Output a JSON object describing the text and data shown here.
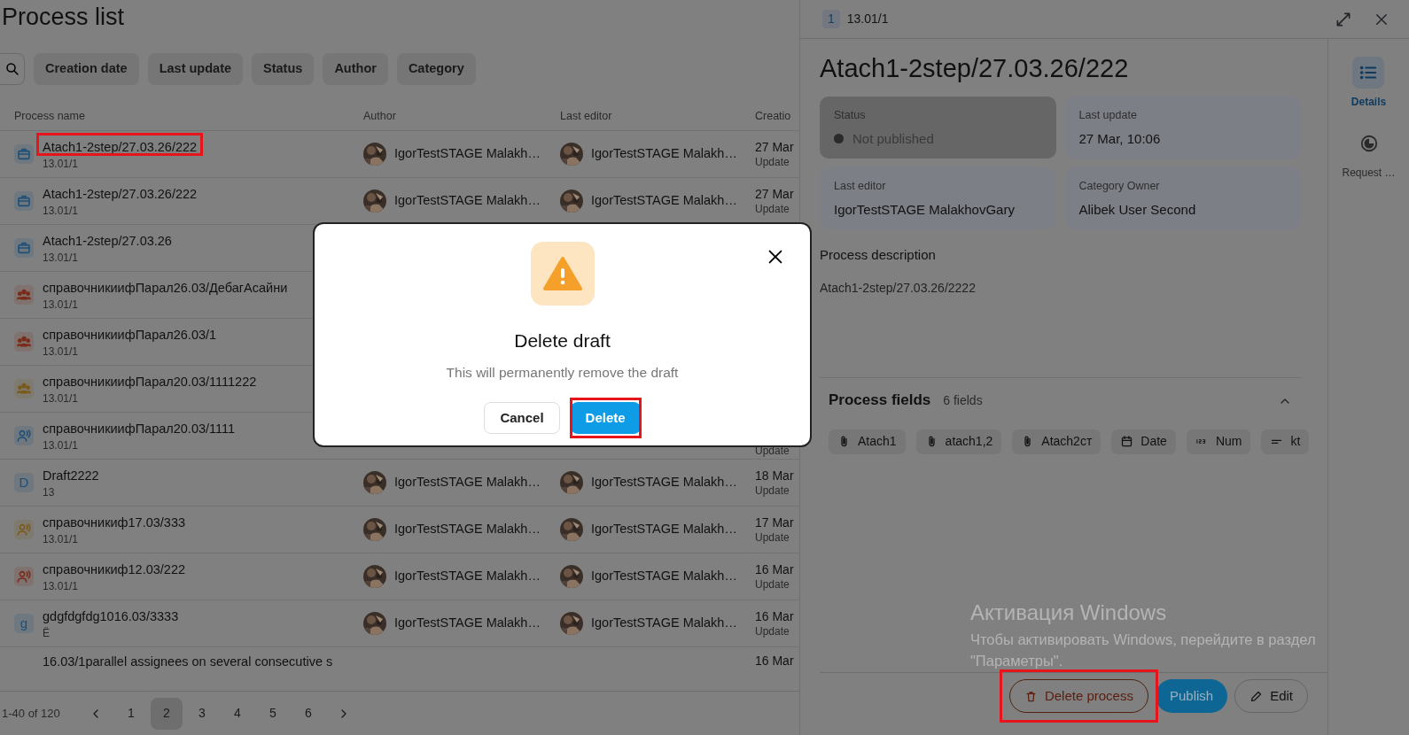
{
  "page_title": "Process list",
  "filters": [
    "Creation date",
    "Last update",
    "Status",
    "Author",
    "Category"
  ],
  "table": {
    "columns": [
      "Process name",
      "Author",
      "Last editor",
      "Creatio"
    ],
    "rows": [
      {
        "name": "Atach1-2step/27.03.26/222",
        "code": "13.01/1",
        "icon": {
          "kind": "briefcase",
          "color": "#1f4f78"
        },
        "author": "IgorTestSTAGE Malakh…",
        "editor": "IgorTestSTAGE Malakh…",
        "created": "27 Mar",
        "updated": "Update",
        "highlighted": true
      },
      {
        "name": "Atach1-2step/27.03.26/222",
        "code": "13.01/1",
        "icon": {
          "kind": "briefcase",
          "color": "#1f4f78"
        },
        "author": "IgorTestSTAGE Malakh…",
        "editor": "IgorTestSTAGE Malakh…",
        "created": "27 Mar",
        "updated": "Update",
        "highlighted": false
      },
      {
        "name": "Atach1-2step/27.03.26",
        "code": "13.01/1",
        "icon": {
          "kind": "briefcase",
          "color": "#1f4f78"
        },
        "highlighted": false
      },
      {
        "name": "справочникиифПарал26.03/ДебагАсайни",
        "code": "13.01/1",
        "icon": {
          "kind": "group",
          "color": "#7a2a18"
        },
        "highlighted": false
      },
      {
        "name": "справочникиифПарал26.03/1",
        "code": "13.01/1",
        "icon": {
          "kind": "group",
          "color": "#7a2a18"
        },
        "highlighted": false
      },
      {
        "name": "справочникиифПарал20.03/1111222",
        "code": "13.01/1",
        "icon": {
          "kind": "group",
          "color": "#7a5a1a"
        },
        "highlighted": false
      },
      {
        "name": "справочникиифПарал20.03/1111",
        "code": "13.01/1",
        "icon": {
          "kind": "voice",
          "color": "#1f4f78"
        },
        "updated": "Update",
        "highlighted": false
      },
      {
        "name": "Draft2222",
        "code": "13",
        "icon": {
          "kind": "letter",
          "letter": "D",
          "color": "#1f4f78"
        },
        "author": "IgorTestSTAGE Malakh…",
        "editor": "IgorTestSTAGE Malakh…",
        "created": "18 Mar",
        "updated": "Update",
        "highlighted": false
      },
      {
        "name": "справочникиф17.03/333",
        "code": "13.01/1",
        "icon": {
          "kind": "voice",
          "color": "#7a5a1a"
        },
        "author": "IgorTestSTAGE Malakh…",
        "editor": "IgorTestSTAGE Malakh…",
        "created": "17 Mar",
        "updated": "Update",
        "highlighted": false
      },
      {
        "name": "справочникиф12.03/222",
        "code": "13.01/1",
        "icon": {
          "kind": "voice",
          "color": "#7a2a18"
        },
        "author": "IgorTestSTAGE Malakh…",
        "editor": "IgorTestSTAGE Malakh…",
        "created": "16 Mar",
        "updated": "Update",
        "highlighted": false
      },
      {
        "name": "gdgfdgfdg1016.03/3333",
        "code": "Ё",
        "icon": {
          "kind": "letter",
          "letter": "g",
          "color": "#1f4f78"
        },
        "author": "IgorTestSTAGE Malakh…",
        "editor": "IgorTestSTAGE Malakh…",
        "created": "16 Mar",
        "updated": "Update",
        "highlighted": false
      },
      {
        "name": "16.03/1parallel assignees on several consecutive s",
        "created": "16 Mar",
        "highlighted": false
      }
    ]
  },
  "pagination": {
    "range": "1-40 of 120",
    "pages": [
      {
        "label": "1",
        "selected": false
      },
      {
        "label": "2",
        "selected": true
      },
      {
        "label": "3",
        "selected": false
      },
      {
        "label": "4",
        "selected": false
      },
      {
        "label": "5",
        "selected": false
      },
      {
        "label": "6",
        "selected": false
      }
    ]
  },
  "detail_panel": {
    "code_badge": "1",
    "code": "13.01/1",
    "title": "Atach1-2step/27.03.26/222",
    "info_cards": [
      {
        "kind": "status",
        "label": "Status",
        "value": "Not published",
        "active": true
      },
      {
        "kind": "text",
        "label": "Last update",
        "value": "27 Mar, 10:06",
        "active": false
      },
      {
        "kind": "text",
        "label": "Last editor",
        "value": "IgorTestSTAGE MalakhovGary",
        "active": false
      },
      {
        "kind": "text",
        "label": "Category Owner",
        "value": "Alibek User Second",
        "active": false
      }
    ],
    "description_label": "Process description",
    "description": "Atach1-2step/27.03.26/2222",
    "fields": {
      "title": "Process fields",
      "count": "6 fields",
      "expanded": true,
      "items": [
        {
          "kind": "attachment",
          "label": "Atach1"
        },
        {
          "kind": "attachment",
          "label": "atach1,2"
        },
        {
          "kind": "attachment",
          "label": "Atach2ст"
        },
        {
          "kind": "date",
          "label": "Date"
        },
        {
          "kind": "number",
          "label": "Num"
        },
        {
          "kind": "text",
          "label": "kt"
        }
      ]
    },
    "actions": [
      {
        "kind": "delete",
        "label": "Delete process",
        "highlighted": true
      },
      {
        "kind": "primary",
        "label": "Publish",
        "highlighted": false
      },
      {
        "kind": "edit",
        "label": "Edit",
        "highlighted": false
      }
    ]
  },
  "side_rail": [
    {
      "kind": "list",
      "label": "Details",
      "selected": true
    },
    {
      "kind": "history",
      "label": "Request …",
      "selected": false
    }
  ],
  "dialog": {
    "title": "Delete draft",
    "message": "This will permanently remove the draft",
    "buttons": [
      {
        "kind": "cancel",
        "label": "Cancel",
        "highlighted": false
      },
      {
        "kind": "danger",
        "label": "Delete",
        "highlighted": true
      }
    ]
  },
  "os_notice": {
    "title": "Активация Windows",
    "text": "Чтобы активировать Windows, перейдите в раздел \"Параметры\"."
  }
}
